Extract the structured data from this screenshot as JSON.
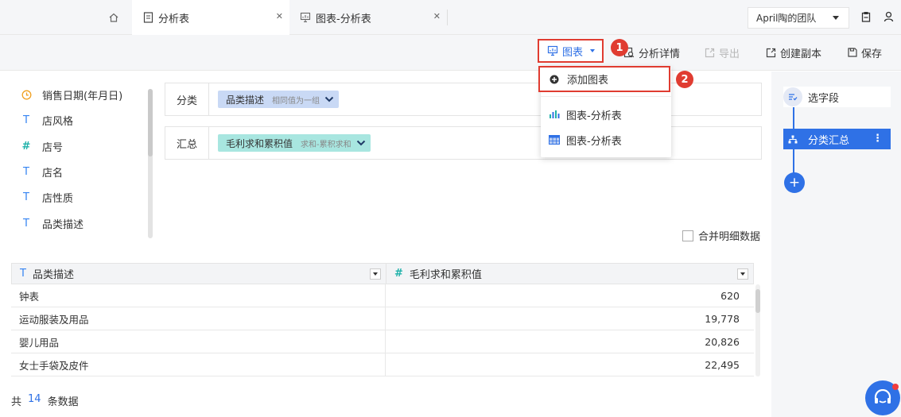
{
  "tabs": {
    "tab1": "分析表",
    "tab2": "图表-分析表",
    "team": "April陶的团队"
  },
  "toolbar": {
    "chart": "图表",
    "detail": "分析详情",
    "export": "导出",
    "copy": "创建副本",
    "save": "保存"
  },
  "badges": [
    "1",
    "2"
  ],
  "fields": [
    {
      "type": "date",
      "icon": "clock-icon",
      "name": "销售日期(年月日)"
    },
    {
      "type": "text",
      "icon": "T",
      "name": "店风格"
    },
    {
      "type": "number",
      "icon": "#",
      "name": "店号"
    },
    {
      "type": "text",
      "icon": "T",
      "name": "店名"
    },
    {
      "type": "text",
      "icon": "T",
      "name": "店性质"
    },
    {
      "type": "text",
      "icon": "T",
      "name": "品类描述"
    }
  ],
  "config": {
    "category_label": "分类",
    "category_chip": "品类描述",
    "category_sub": "相同值为一组",
    "summary_label": "汇总",
    "summary_chip": "毛利求和累积值",
    "summary_sub": "求和-累积求和",
    "merge_label": "合并明细数据"
  },
  "table": {
    "headers": [
      {
        "icon": "T",
        "label": "品类描述"
      },
      {
        "icon": "#",
        "label": "毛利求和累积值"
      }
    ],
    "rows": [
      [
        "钟表",
        "620"
      ],
      [
        "运动服装及用品",
        "19,778"
      ],
      [
        "婴儿用品",
        "20,826"
      ],
      [
        "女士手袋及皮件",
        "22,495"
      ]
    ]
  },
  "footer": {
    "prefix": "共",
    "count": "14",
    "suffix": "条数据"
  },
  "steps": {
    "select": "选字段",
    "group": "分类汇总"
  },
  "dropdown": {
    "add": "添加图表",
    "item1": "图表-分析表",
    "item2": "图表-分析表"
  },
  "colors": {
    "accent": "#2f71e6",
    "highlight": "#e03c31",
    "chip_category": "#c9d9f5",
    "chip_summary": "#a8e6e0"
  }
}
